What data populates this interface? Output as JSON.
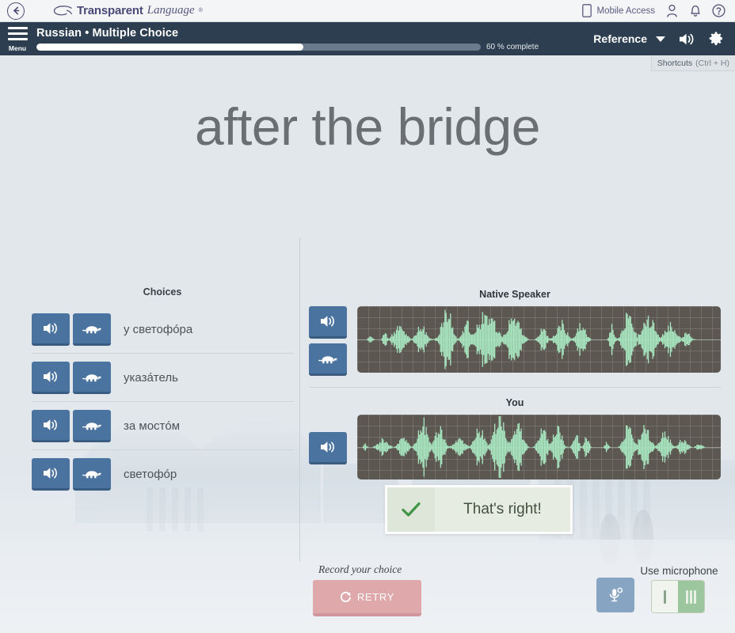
{
  "brand": {
    "back_icon": "back-arrow-icon",
    "name_bold": "Transparent",
    "name_italic": "Language",
    "registered": "®",
    "mobile_access_label": "Mobile Access",
    "icons": [
      "tablet-icon",
      "account-icon",
      "bell-icon",
      "help-icon"
    ]
  },
  "lesson": {
    "menu_label": "Menu",
    "title": "Russian • Multiple Choice",
    "progress_percent": 60,
    "progress_label": "60 % complete",
    "reference_label": "Reference",
    "speaker_icon": "speaker-icon",
    "settings_icon": "gear-icon"
  },
  "shortcuts": {
    "label": "Shortcuts",
    "keys": "(Ctrl + H)"
  },
  "prompt": {
    "text": "after the bridge"
  },
  "choices": {
    "title": "Choices",
    "items": [
      {
        "text": "у светофóра"
      },
      {
        "text": "указáтель"
      },
      {
        "text": "за мостóм"
      },
      {
        "text": "светофóр"
      }
    ],
    "play_icon": "speaker-icon",
    "slow_icon": "turtle-icon"
  },
  "audio": {
    "native": {
      "title": "Native Speaker",
      "play_icon": "speaker-icon",
      "slow_icon": "turtle-icon"
    },
    "you": {
      "title": "You",
      "play_icon": "speaker-icon"
    }
  },
  "feedback": {
    "check_icon": "check-icon",
    "message": "That's right!"
  },
  "bottom": {
    "record_label": "Record your choice",
    "retry_label": "RETRY",
    "retry_icon": "refresh-icon",
    "mic_settings_icon": "microphone-settings-icon",
    "use_microphone_label": "Use microphone",
    "toggle_off_label": "I",
    "toggle_on_label": "III",
    "toggle_state": "on"
  },
  "colors": {
    "header_dark": "#2c3e50",
    "button_blue": "#4a739f",
    "waveform_green": "#a8e6c0",
    "waveform_bg": "#5c5751",
    "retry_pink": "#dfa8ab",
    "toggle_green": "#9cc79e",
    "page_bg": "#e2e7ec"
  }
}
